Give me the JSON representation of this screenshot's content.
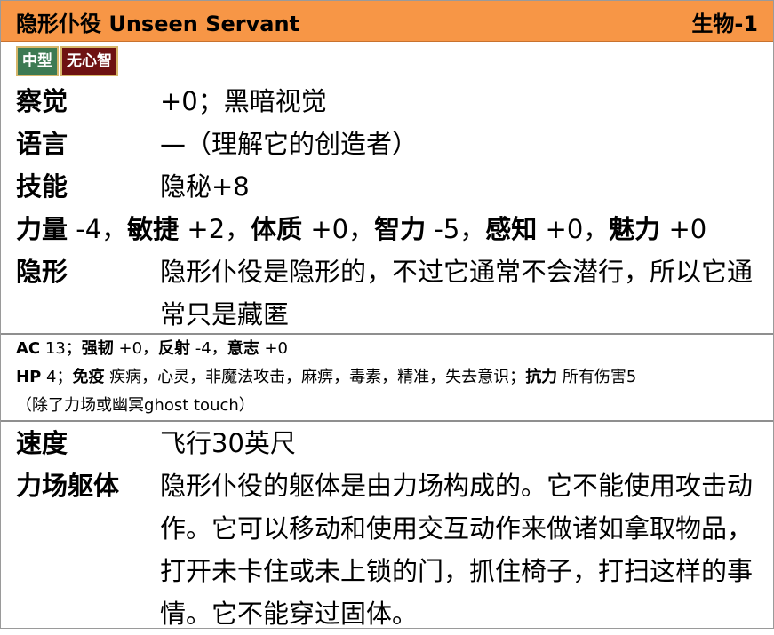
{
  "creature": {
    "name": "隐形仆役 Unseen Servant",
    "level": "生物-1"
  },
  "traits": [
    {
      "label": "中型",
      "color": "#3d7a53"
    },
    {
      "label": "无心智",
      "color": "#6e1212"
    }
  ],
  "perception": {
    "label": "察觉",
    "value": "+0；黑暗视觉"
  },
  "languages": {
    "label": "语言",
    "value": "—（理解它的创造者）"
  },
  "skills": {
    "label": "技能",
    "value": "隐秘+8"
  },
  "abilities": {
    "str_label": "力量",
    "str": " -4，",
    "dex_label": "敏捷",
    "dex": " +2，",
    "con_label": "体质",
    "con": " +0，",
    "int_label": "智力",
    "int": " -5，",
    "wis_label": "感知",
    "wis": " +0，",
    "cha_label": "魅力",
    "cha": " +0"
  },
  "invisible": {
    "label": "隐形",
    "value": "隐形仆役是隐形的，不过它通常不会潜行，所以它通常只是藏匿"
  },
  "defense": {
    "ac_label": "AC",
    "ac": " 13；",
    "fort_label": "强韧",
    "fort": " +0，",
    "ref_label": "反射",
    "ref": " -4，",
    "will_label": "意志",
    "will": " +0",
    "hp_label": "HP",
    "hp": " 4；",
    "immunities_label": "免疫",
    "immunities": " 疾病，心灵，非魔法攻击，麻痹，毒素，精准，失去意识；",
    "resistances_label": "抗力",
    "resistances": " 所有伤害5",
    "resistance_note": "（除了力场或幽冥ghost touch）"
  },
  "speed": {
    "label": "速度",
    "value": "飞行30英尺"
  },
  "force_body": {
    "label": "力场躯体",
    "value": "隐形仆役的躯体是由力场构成的。它不能使用攻击动作。它可以移动和使用交互动作来做诸如拿取物品，打开未卡住或未上锁的门，抓住椅子，打扫这样的事情。它不能穿过固体。"
  }
}
